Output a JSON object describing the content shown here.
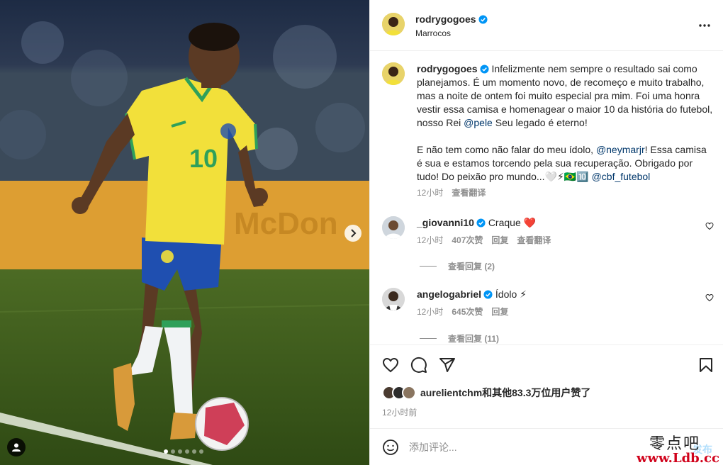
{
  "post": {
    "username": "rodrygogoes",
    "location": "Marrocos",
    "caption_para1": "Infelizmente nem sempre o resultado sai como planejamos. É um momento novo, de recomeço e muito trabalho, mas a noite de ontem foi muito especial pra mim. Foi uma honra vestir essa camisa e homenagear o maior 10 da história do futebol, nosso Rei ",
    "mention_pele": "@pele",
    "caption_para1_end": " Seu legado é eterno!",
    "caption_para2": "E não tem como não falar do meu ídolo, ",
    "mention_neymar": "@neymarjr",
    "caption_para2_mid": "! Essa camisa é sua e estamos torcendo pela sua recuperação. Obrigado por tudo! Do peixão pro mundo...🤍⚡🇧🇷🔟 ",
    "mention_cbf": "@cbf_futebol",
    "caption_time": "12小时",
    "caption_translate": "查看翻译",
    "jersey_number": "10",
    "carousel_count": 6,
    "carousel_active": 1
  },
  "comments": [
    {
      "username": "_giovanni10",
      "text": "Craque ❤️",
      "time": "12小时",
      "likes": "407次赞",
      "reply": "回复",
      "translate": "查看翻译",
      "view_replies": "查看回复 (2)"
    },
    {
      "username": "angelogabriel",
      "text": "Ídolo ⚡",
      "time": "12小时",
      "likes": "645次赞",
      "reply": "回复",
      "view_replies": "查看回复 (11)"
    }
  ],
  "actions": {
    "likes_text": "aurelientchm和其他83.3万位用户赞了",
    "timestamp": "12小时前"
  },
  "composer": {
    "placeholder": "添加评论...",
    "post_label": "发布"
  },
  "watermark": {
    "line1": "零点吧",
    "line2": "www.Ldb.cc"
  },
  "colors": {
    "verified": "#0095f6",
    "link": "#00376b",
    "jersey_yellow": "#f2e03a",
    "shorts_blue": "#1f4fb0",
    "heart_red": "#ed4956"
  },
  "icons": [
    "more-options-icon",
    "verified-icon",
    "heart-icon",
    "comment-icon",
    "share-icon",
    "bookmark-icon",
    "emoji-icon",
    "chevron-right-icon",
    "user-tag-icon"
  ]
}
